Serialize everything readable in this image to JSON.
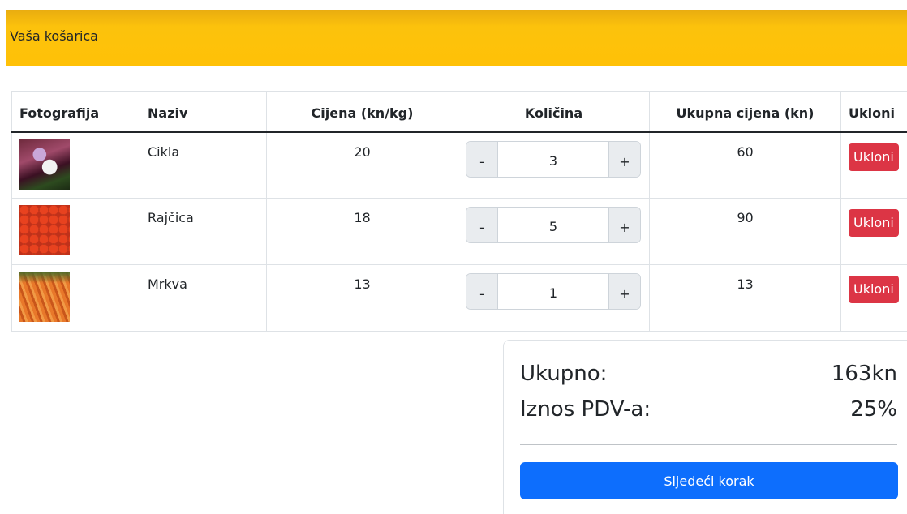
{
  "header": {
    "title": "Vaša košarica"
  },
  "table": {
    "columns": [
      "Fotografija",
      "Naziv",
      "Cijena (kn/kg)",
      "Količina",
      "Ukupna cijena (kn)",
      "Ukloni"
    ],
    "rows": [
      {
        "photo": "beet-photo",
        "name": "Cikla",
        "price": "20",
        "quantity": "3",
        "total": "60",
        "remove_label": "Ukloni",
        "minus": "-",
        "plus": "+"
      },
      {
        "photo": "tomato-photo",
        "name": "Rajčica",
        "price": "18",
        "quantity": "5",
        "total": "90",
        "remove_label": "Ukloni",
        "minus": "-",
        "plus": "+"
      },
      {
        "photo": "carrot-photo",
        "name": "Mrkva",
        "price": "13",
        "quantity": "1",
        "total": "13",
        "remove_label": "Ukloni",
        "minus": "-",
        "plus": "+"
      }
    ]
  },
  "summary": {
    "total_label": "Ukupno:",
    "total_value": "163kn",
    "vat_label": "Iznos PDV-a:",
    "vat_value": "25%",
    "next_button": "Sljedeći korak"
  },
  "colors": {
    "header_bg": "#ffc107",
    "remove_button": "#dc3545",
    "primary_button": "#0d6efd"
  }
}
